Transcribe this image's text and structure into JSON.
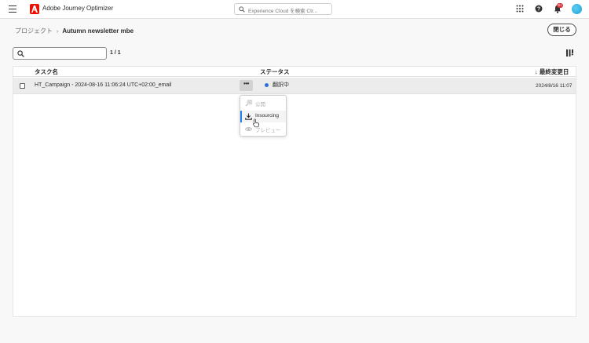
{
  "app": {
    "title": "Adobe Journey Optimizer"
  },
  "search": {
    "placeholder": "Experience Cloud を検索 Ctr..."
  },
  "notifications": {
    "badge": "9+"
  },
  "breadcrumb": {
    "parent": "プロジェクト",
    "separator": "›",
    "current": "Autumn newsletter mbe"
  },
  "close_button": "閉じる",
  "filter": {
    "placeholder": "",
    "count": "1 / 1"
  },
  "table": {
    "columns": {
      "task_name": "タスク名",
      "status": "ステータス",
      "last_modified": "↓ 最終変更日"
    },
    "rows": [
      {
        "name": "HT_Campaign - 2024-08-16 11:06:24 UTC+02:00_email",
        "status": "翻訳中",
        "modified": "2024/8/16 11:07"
      }
    ]
  },
  "row_menu": {
    "more_label": "•••",
    "items": [
      {
        "label": "公開",
        "icon": "publish-icon",
        "enabled": false
      },
      {
        "label": "Insourcing",
        "icon": "download-icon",
        "enabled": true
      },
      {
        "label": "プレビュー",
        "icon": "eye-icon",
        "enabled": false
      }
    ]
  },
  "colors": {
    "accent": "#2680eb",
    "status_dot": "#2d6fd6",
    "brand": "#eb1000"
  }
}
